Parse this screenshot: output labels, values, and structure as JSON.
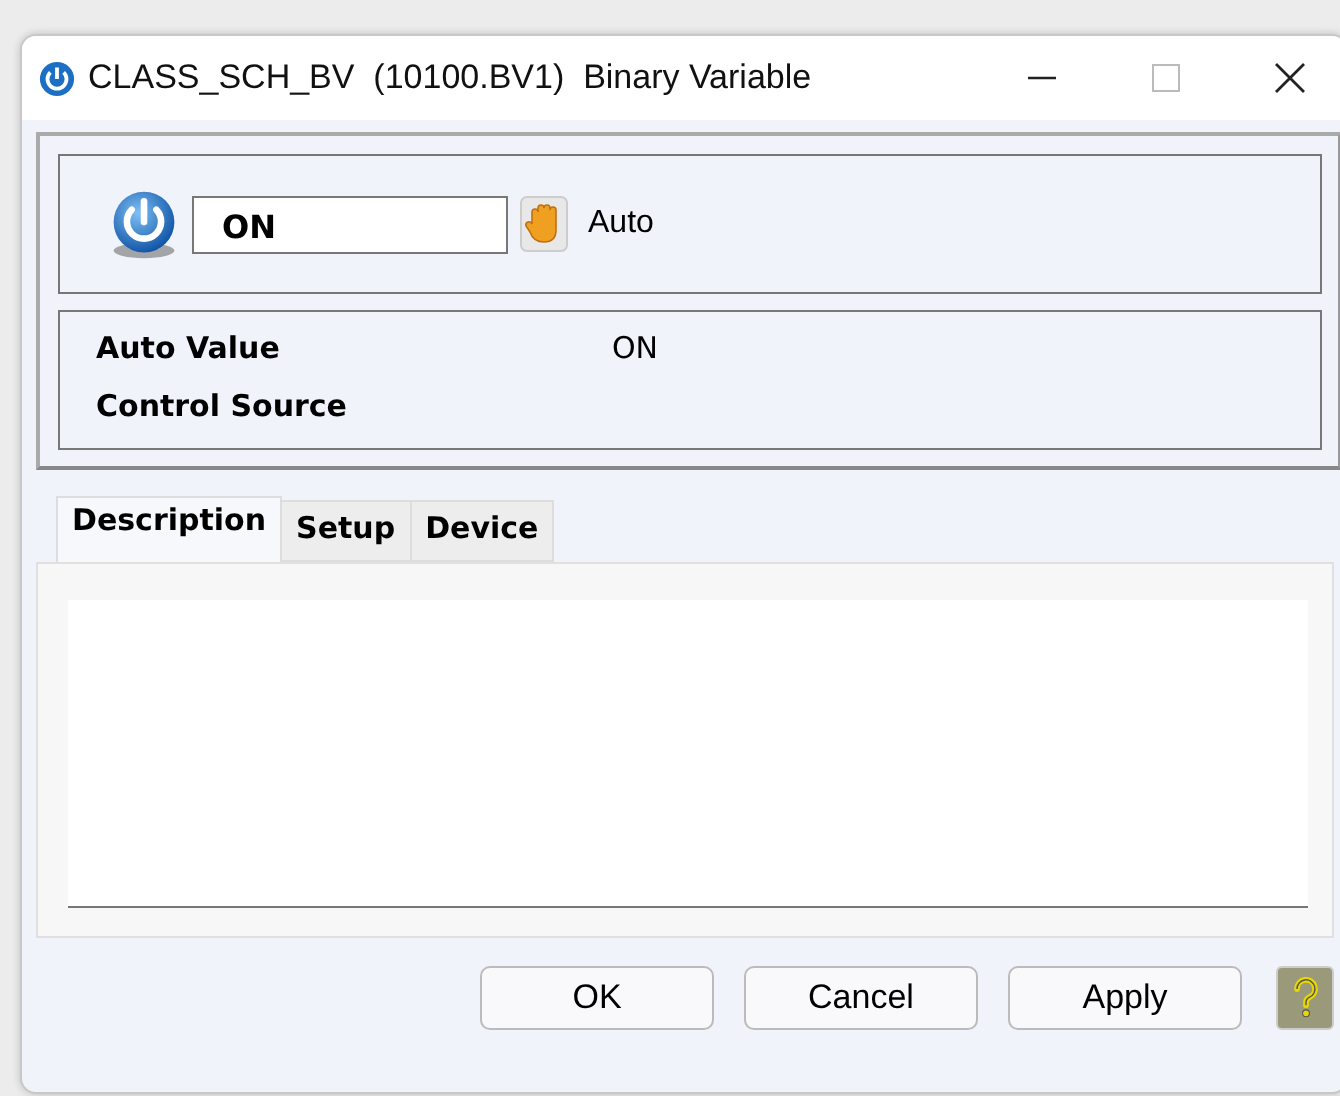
{
  "window": {
    "title": "CLASS_SCH_BV  (10100.BV1)  Binary Variable"
  },
  "command": {
    "value": "ON",
    "mode": "Auto"
  },
  "properties": [
    {
      "label": "Auto Value",
      "value": "ON"
    },
    {
      "label": "Control Source"
    }
  ],
  "tabs": [
    {
      "label": "Description",
      "selected": true
    },
    {
      "label": "Setup",
      "selected": false
    },
    {
      "label": "Device",
      "selected": false
    }
  ],
  "buttons": [
    "OK",
    "Cancel",
    "Apply"
  ]
}
